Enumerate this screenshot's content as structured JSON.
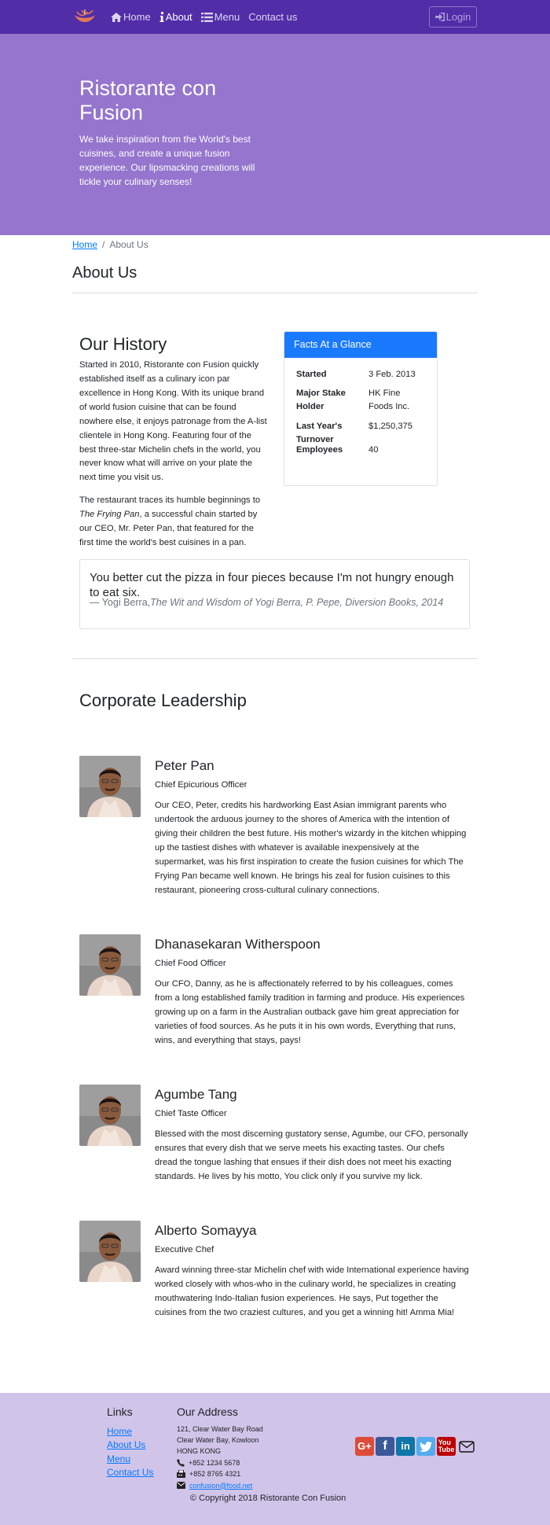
{
  "nav": {
    "home": "Home",
    "about": "About",
    "menu": "Menu",
    "contact": "Contact us",
    "login": "Login",
    "accent": "#512DA8"
  },
  "jumbotron": {
    "title": "Ristorante con Fusion",
    "text": "We take inspiration from the World's best cuisines, and create a unique fusion experience. Our lipsmacking creations will tickle your culinary senses!"
  },
  "breadcrumb": {
    "home": "Home",
    "current": "About Us"
  },
  "page_title": "About Us",
  "history": {
    "title": "Our History",
    "p1": "Started in 2010, Ristorante con Fusion quickly established itself as a culinary icon par excellence in Hong Kong. With its unique brand of world fusion cuisine that can be found nowhere else, it enjoys patronage from the A-list clientele in Hong Kong. Featuring four of the best three-star Michelin chefs in the world, you never know what will arrive on your plate the next time you visit us.",
    "p2_before": "The restaurant traces its humble beginnings to ",
    "p2_italic": "The Frying Pan",
    "p2_after": ", a successful chain started by our CEO, Mr. Peter Pan, that featured for the first time the world's best cuisines in a pan."
  },
  "facts": {
    "header": "Facts At a Glance",
    "rows": [
      {
        "label": "Started",
        "value": "3 Feb. 2013"
      },
      {
        "label": "Major Stake Holder",
        "value": "HK Fine Foods Inc."
      },
      {
        "label": "Last Year's Turnover",
        "value": "$1,250,375"
      },
      {
        "label": "Employees",
        "value": "40"
      }
    ]
  },
  "quote": {
    "text": "You better cut the pizza in four pieces because I'm not hungry enough to eat six.",
    "author": "— Yogi Berra,",
    "source": "The Wit and Wisdom of Yogi Berra, P. Pepe, Diversion Books, 2014"
  },
  "leadership": {
    "title": "Corporate Leadership",
    "leaders": [
      {
        "name": "Peter Pan",
        "role": "Chief Epicurious Officer",
        "desc": "Our CEO, Peter, credits his hardworking East Asian immigrant parents who undertook the arduous journey to the shores of America with the intention of giving their children the best future. His mother's wizardy in the kitchen whipping up the tastiest dishes with whatever is available inexpensively at the supermarket, was his first inspiration to create the fusion cuisines for which The Frying Pan became well known. He brings his zeal for fusion cuisines to this restaurant, pioneering cross-cultural culinary connections."
      },
      {
        "name": "Dhanasekaran Witherspoon",
        "role": "Chief Food Officer",
        "desc": "Our CFO, Danny, as he is affectionately referred to by his colleagues, comes from a long established family tradition in farming and produce. His experiences growing up on a farm in the Australian outback gave him great appreciation for varieties of food sources. As he puts it in his own words, Everything that runs, wins, and everything that stays, pays!"
      },
      {
        "name": "Agumbe Tang",
        "role": "Chief Taste Officer",
        "desc": "Blessed with the most discerning gustatory sense, Agumbe, our CFO, personally ensures that every dish that we serve meets his exacting tastes. Our chefs dread the tongue lashing that ensues if their dish does not meet his exacting standards. He lives by his motto, You click only if you survive my lick."
      },
      {
        "name": "Alberto Somayya",
        "role": "Executive Chef",
        "desc": "Award winning three-star Michelin chef with wide International experience having worked closely with whos-who in the culinary world, he specializes in creating mouthwatering Indo-Italian fusion experiences. He says, Put together the cuisines from the two craziest cultures, and you get a winning hit! Amma Mia!"
      }
    ]
  },
  "footer": {
    "links_title": "Links",
    "links": [
      "Home",
      "About Us",
      "Menu",
      "Contact Us"
    ],
    "address_title": "Our Address",
    "address": [
      "121, Clear Water Bay Road",
      "Clear Water Bay, Kowloon",
      "HONG KONG"
    ],
    "phone": "+852 1234 5678",
    "fax": "+852 8765 4321",
    "email": "confusion@food.net",
    "copyright": "© Copyright 2018 Ristorante Con Fusion",
    "social": [
      "google-plus",
      "facebook",
      "linkedin",
      "twitter",
      "youtube",
      "mail"
    ]
  }
}
